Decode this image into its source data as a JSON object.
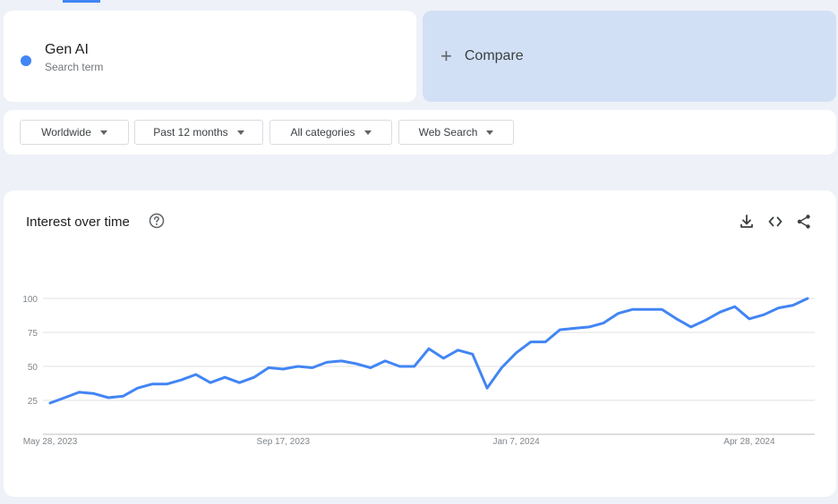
{
  "search_term": {
    "name": "Gen AI",
    "subtitle": "Search term",
    "color": "#4285f4"
  },
  "compare": {
    "label": "Compare",
    "icon": "plus-icon"
  },
  "filters": [
    {
      "label": "Worldwide"
    },
    {
      "label": "Past 12 months"
    },
    {
      "label": "All categories"
    },
    {
      "label": "Web Search"
    }
  ],
  "chart_card": {
    "title": "Interest over time",
    "icons": [
      "help-icon",
      "download-icon",
      "embed-icon",
      "share-icon"
    ]
  },
  "chart_data": {
    "type": "line",
    "title": "Interest over time",
    "xlabel": "",
    "ylabel": "",
    "ylim": [
      0,
      100
    ],
    "yticks": [
      25,
      50,
      75,
      100
    ],
    "x_tick_labels": [
      "May 28, 2023",
      "Sep 17, 2023",
      "Jan 7, 2024",
      "Apr 28, 2024"
    ],
    "grid": true,
    "x": [
      "2023-05-28",
      "2023-06-04",
      "2023-06-11",
      "2023-06-18",
      "2023-06-25",
      "2023-07-02",
      "2023-07-09",
      "2023-07-16",
      "2023-07-23",
      "2023-07-30",
      "2023-08-06",
      "2023-08-13",
      "2023-08-20",
      "2023-08-27",
      "2023-09-03",
      "2023-09-10",
      "2023-09-17",
      "2023-09-24",
      "2023-10-01",
      "2023-10-08",
      "2023-10-15",
      "2023-10-22",
      "2023-10-29",
      "2023-11-05",
      "2023-11-12",
      "2023-11-19",
      "2023-11-26",
      "2023-12-03",
      "2023-12-10",
      "2023-12-17",
      "2023-12-24",
      "2023-12-31",
      "2024-01-07",
      "2024-01-14",
      "2024-01-21",
      "2024-01-28",
      "2024-02-04",
      "2024-02-11",
      "2024-02-18",
      "2024-02-25",
      "2024-03-03",
      "2024-03-10",
      "2024-03-17",
      "2024-03-24",
      "2024-03-31",
      "2024-04-07",
      "2024-04-14",
      "2024-04-21",
      "2024-04-28",
      "2024-05-05",
      "2024-05-12",
      "2024-05-19",
      "2024-05-26"
    ],
    "series": [
      {
        "color": "#4285f4",
        "values": [
          23,
          27,
          31,
          30,
          27,
          28,
          34,
          37,
          37,
          40,
          44,
          38,
          42,
          38,
          42,
          49,
          48,
          50,
          49,
          53,
          54,
          52,
          49,
          54,
          50,
          50,
          63,
          56,
          62,
          59,
          34,
          49,
          60,
          68,
          68,
          77,
          78,
          79,
          82,
          89,
          92,
          92,
          92,
          85,
          79,
          84,
          90,
          94,
          85,
          88,
          93,
          95,
          100
        ]
      }
    ]
  }
}
